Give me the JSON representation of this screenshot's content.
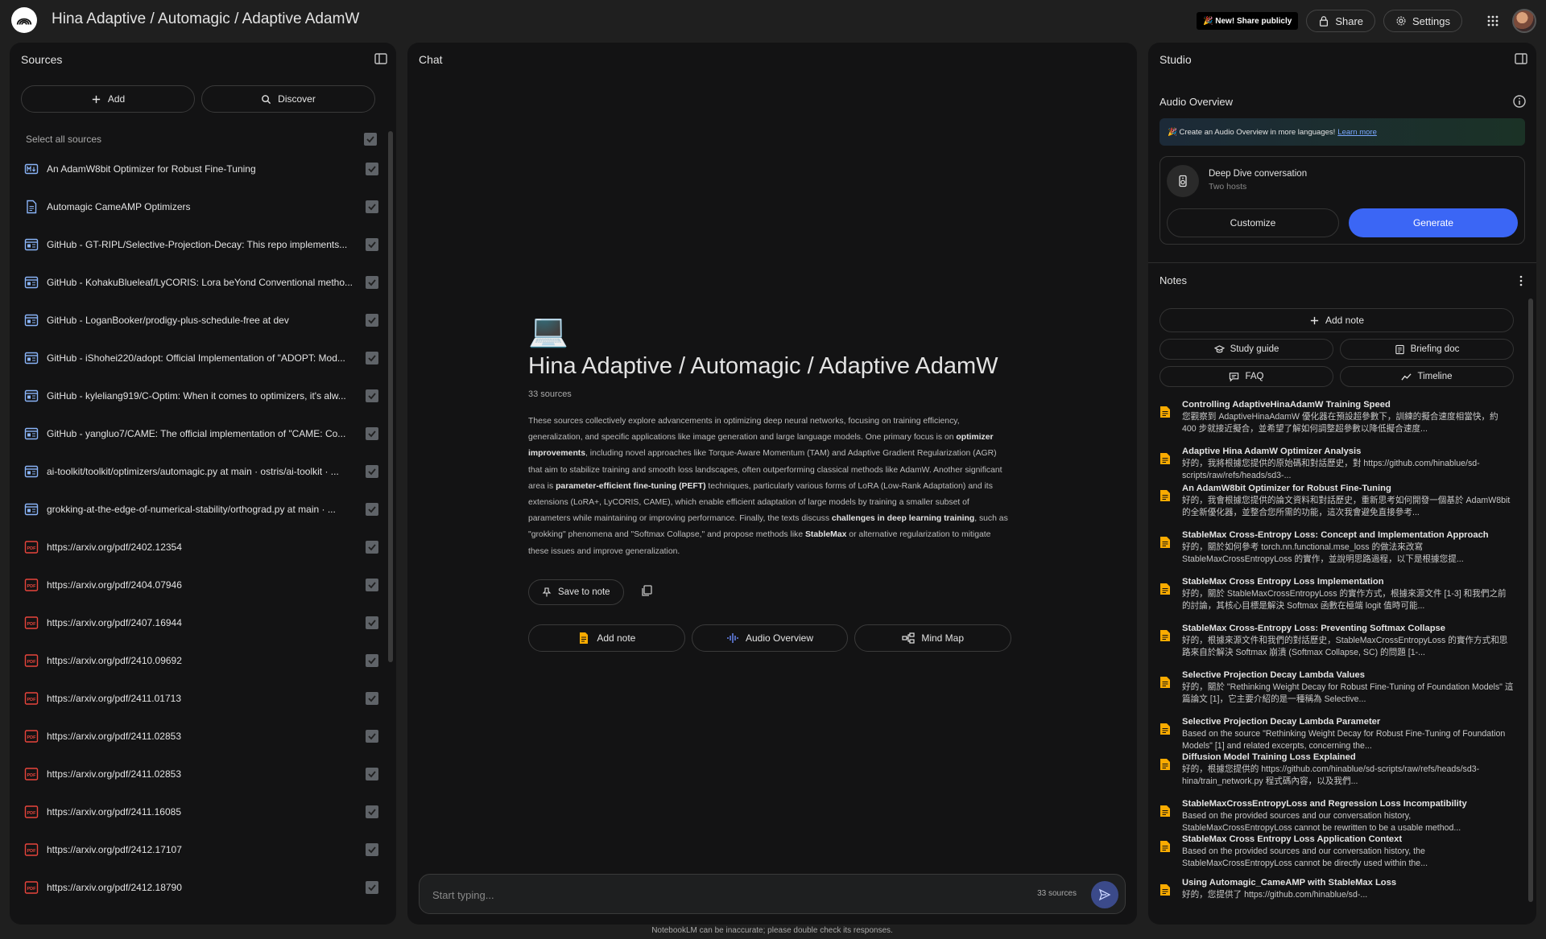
{
  "app": {
    "title": "Hina Adaptive / Automagic / Adaptive AdamW",
    "new_badge": "🎉 New! Share publicly",
    "share_label": "Share",
    "settings_label": "Settings"
  },
  "sources": {
    "title": "Sources",
    "add_label": "Add",
    "discover_label": "Discover",
    "select_all_label": "Select all sources",
    "items": [
      {
        "label": "An AdamW8bit Optimizer for Robust Fine-Tuning",
        "icon": "markdown-icon"
      },
      {
        "label": "Automagic CameAMP Optimizers",
        "icon": "document-icon"
      },
      {
        "label": "GitHub - GT-RIPL/Selective-Projection-Decay: This repo implements...",
        "icon": "web-icon"
      },
      {
        "label": "GitHub - KohakuBlueleaf/LyCORIS: Lora beYond Conventional metho...",
        "icon": "web-icon"
      },
      {
        "label": "GitHub - LoganBooker/prodigy-plus-schedule-free at dev",
        "icon": "web-icon"
      },
      {
        "label": "GitHub - iShohei220/adopt: Official Implementation of \"ADOPT: Mod...",
        "icon": "web-icon"
      },
      {
        "label": "GitHub - kyleliang919/C-Optim: When it comes to optimizers, it's alw...",
        "icon": "web-icon"
      },
      {
        "label": "GitHub - yangluo7/CAME: The official implementation of \"CAME: Co...",
        "icon": "web-icon"
      },
      {
        "label": "ai-toolkit/toolkit/optimizers/automagic.py at main · ostris/ai-toolkit · ...",
        "icon": "web-icon"
      },
      {
        "label": "grokking-at-the-edge-of-numerical-stability/orthograd.py at main · ...",
        "icon": "web-icon"
      },
      {
        "label": "https://arxiv.org/pdf/2402.12354",
        "icon": "pdf-icon"
      },
      {
        "label": "https://arxiv.org/pdf/2404.07946",
        "icon": "pdf-icon"
      },
      {
        "label": "https://arxiv.org/pdf/2407.16944",
        "icon": "pdf-icon"
      },
      {
        "label": "https://arxiv.org/pdf/2410.09692",
        "icon": "pdf-icon"
      },
      {
        "label": "https://arxiv.org/pdf/2411.01713",
        "icon": "pdf-icon"
      },
      {
        "label": "https://arxiv.org/pdf/2411.02853",
        "icon": "pdf-icon"
      },
      {
        "label": "https://arxiv.org/pdf/2411.02853",
        "icon": "pdf-icon"
      },
      {
        "label": "https://arxiv.org/pdf/2411.16085",
        "icon": "pdf-icon"
      },
      {
        "label": "https://arxiv.org/pdf/2412.17107",
        "icon": "pdf-icon"
      },
      {
        "label": "https://arxiv.org/pdf/2412.18790",
        "icon": "pdf-icon"
      }
    ]
  },
  "chat": {
    "title": "Chat",
    "emoji": "💻",
    "notebook_title": "Hina Adaptive / Automagic / Adaptive AdamW",
    "source_count": "33 sources",
    "summary": [
      {
        "text": "These sources collectively explore advancements in optimizing deep neural networks, focusing on training efficiency, generalization, and specific applications like image generation and large language models. One primary focus is on ",
        "bold": false
      },
      {
        "text": "optimizer improvements",
        "bold": true
      },
      {
        "text": ", including novel approaches like Torque-Aware Momentum (TAM) and Adaptive Gradient Regularization (AGR) that aim to stabilize training and smooth loss landscapes, often outperforming classical methods like AdamW. Another significant area is ",
        "bold": false
      },
      {
        "text": "parameter-efficient fine-tuning (PEFT)",
        "bold": true
      },
      {
        "text": " techniques, particularly various forms of LoRA (Low-Rank Adaptation) and its extensions (LoRA+, LyCORIS, CAME), which enable efficient adaptation of large models by training a smaller subset of parameters while maintaining or improving performance. Finally, the texts discuss ",
        "bold": false
      },
      {
        "text": "challenges in deep learning training",
        "bold": true
      },
      {
        "text": ", such as \"grokking\" phenomena and \"Softmax Collapse,\" and propose methods like ",
        "bold": false
      },
      {
        "text": "StableMax",
        "bold": true
      },
      {
        "text": " or alternative regularization to mitigate these issues and improve generalization.",
        "bold": false
      }
    ],
    "save_to_note_label": "Save to note",
    "actions": {
      "add_note": "Add note",
      "audio_overview": "Audio Overview",
      "mind_map": "Mind Map"
    },
    "input_placeholder": "Start typing...",
    "input_count": "33 sources",
    "disclaimer": "NotebookLM can be inaccurate; please double check its responses."
  },
  "studio": {
    "title": "Studio",
    "audio_overview_title": "Audio Overview",
    "banner_text": "🎉 Create an Audio Overview in more languages!",
    "banner_link": "Learn more",
    "deep_dive_title": "Deep Dive conversation",
    "deep_dive_sub": "Two hosts",
    "customize_label": "Customize",
    "generate_label": "Generate",
    "notes_title": "Notes",
    "add_note_label": "Add note",
    "tools": {
      "study_guide": "Study guide",
      "briefing_doc": "Briefing doc",
      "faq": "FAQ",
      "timeline": "Timeline"
    },
    "notes": [
      {
        "title": "Controlling AdaptiveHinaAdamW Training Speed",
        "body": "您觀察到 AdaptiveHinaAdamW 優化器在預設超參數下，訓練的擬合速度相當快，約 400 步就接近擬合，並希望了解如何調整超參數以降低擬合速度..."
      },
      {
        "title": "Adaptive Hina AdamW Optimizer Analysis",
        "body": "好的，我將根據您提供的原始碼和對話歷史，對 https://github.com/hinablue/sd-scripts/raw/refs/heads/sd3-..."
      },
      {
        "title": "An AdamW8bit Optimizer for Robust Fine-Tuning",
        "body": "好的，我會根據您提供的論文資料和對話歷史，重新思考如何開發一個基於 AdamW8bit 的全新優化器，並整合您所需的功能，這次我會避免直接參考..."
      },
      {
        "title": "StableMax Cross-Entropy Loss: Concept and Implementation Approach",
        "body": "好的，關於如何參考 torch.nn.functional.mse_loss 的做法來改寫 StableMaxCrossEntropyLoss 的實作，並說明思路過程，以下是根據您提..."
      },
      {
        "title": "StableMax Cross Entropy Loss Implementation",
        "body": "好的，關於 StableMaxCrossEntropyLoss 的實作方式，根據來源文件 [1-3] 和我們之前的討論，其核心目標是解決 Softmax 函數在極端 logit 值時可能..."
      },
      {
        "title": "StableMax Cross-Entropy Loss: Preventing Softmax Collapse",
        "body": "好的，根據來源文件和我們的對話歷史，StableMaxCrossEntropyLoss 的實作方式和思路來自於解決 Softmax 崩潰 (Softmax Collapse, SC) 的問題 [1-..."
      },
      {
        "title": "Selective Projection Decay Lambda Values",
        "body": "好的，關於 \"Rethinking Weight Decay for Robust Fine-Tuning of Foundation Models\" 這篇論文 [1]，它主要介紹的是一種稱為 Selective..."
      },
      {
        "title": "Selective Projection Decay Lambda Parameter",
        "body": "Based on the source \"Rethinking Weight Decay for Robust Fine-Tuning of Foundation Models\" [1] and related excerpts, concerning the..."
      },
      {
        "title": "Diffusion Model Training Loss Explained",
        "body": "好的，根據您提供的 https://github.com/hinablue/sd-scripts/raw/refs/heads/sd3-hina/train_network.py 程式碼內容，以及我們..."
      },
      {
        "title": "StableMaxCrossEntropyLoss and Regression Loss Incompatibility",
        "body": "Based on the provided sources and our conversation history, StableMaxCrossEntropyLoss cannot be rewritten to be a usable method..."
      },
      {
        "title": "StableMax Cross Entropy Loss Application Context",
        "body": "Based on the provided sources and our conversation history, the StableMaxCrossEntropyLoss cannot be directly used within the..."
      },
      {
        "title": "Using Automagic_CameAMP with StableMax Loss",
        "body": "好的，您提供了 https://github.com/hinablue/sd-..."
      }
    ]
  },
  "colors": {
    "background": "#1f1f1f",
    "panel": "#131314",
    "accent_blue": "#3b66f5",
    "pdf_red": "#e8453c",
    "web_blue": "#8ab4f8",
    "note_orange": "#f9ab00"
  }
}
